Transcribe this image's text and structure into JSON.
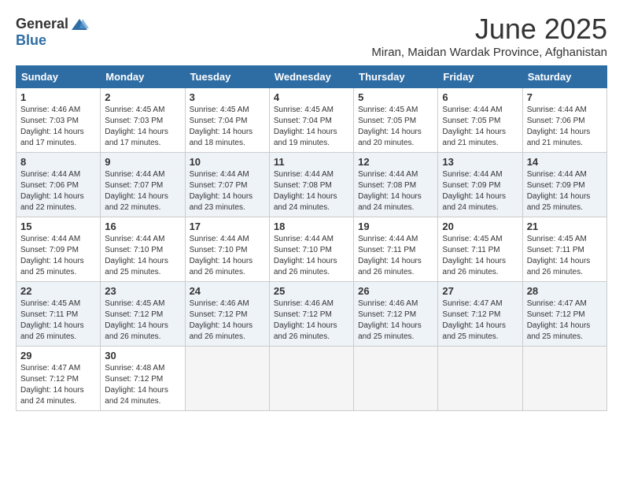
{
  "logo": {
    "general": "General",
    "blue": "Blue"
  },
  "title": "June 2025",
  "location": "Miran, Maidan Wardak Province, Afghanistan",
  "days_header": [
    "Sunday",
    "Monday",
    "Tuesday",
    "Wednesday",
    "Thursday",
    "Friday",
    "Saturday"
  ],
  "weeks": [
    [
      {
        "day": 1,
        "lines": [
          "Sunrise: 4:46 AM",
          "Sunset: 7:03 PM",
          "Daylight: 14 hours",
          "and 17 minutes."
        ]
      },
      {
        "day": 2,
        "lines": [
          "Sunrise: 4:45 AM",
          "Sunset: 7:03 PM",
          "Daylight: 14 hours",
          "and 17 minutes."
        ]
      },
      {
        "day": 3,
        "lines": [
          "Sunrise: 4:45 AM",
          "Sunset: 7:04 PM",
          "Daylight: 14 hours",
          "and 18 minutes."
        ]
      },
      {
        "day": 4,
        "lines": [
          "Sunrise: 4:45 AM",
          "Sunset: 7:04 PM",
          "Daylight: 14 hours",
          "and 19 minutes."
        ]
      },
      {
        "day": 5,
        "lines": [
          "Sunrise: 4:45 AM",
          "Sunset: 7:05 PM",
          "Daylight: 14 hours",
          "and 20 minutes."
        ]
      },
      {
        "day": 6,
        "lines": [
          "Sunrise: 4:44 AM",
          "Sunset: 7:05 PM",
          "Daylight: 14 hours",
          "and 21 minutes."
        ]
      },
      {
        "day": 7,
        "lines": [
          "Sunrise: 4:44 AM",
          "Sunset: 7:06 PM",
          "Daylight: 14 hours",
          "and 21 minutes."
        ]
      }
    ],
    [
      {
        "day": 8,
        "lines": [
          "Sunrise: 4:44 AM",
          "Sunset: 7:06 PM",
          "Daylight: 14 hours",
          "and 22 minutes."
        ]
      },
      {
        "day": 9,
        "lines": [
          "Sunrise: 4:44 AM",
          "Sunset: 7:07 PM",
          "Daylight: 14 hours",
          "and 22 minutes."
        ]
      },
      {
        "day": 10,
        "lines": [
          "Sunrise: 4:44 AM",
          "Sunset: 7:07 PM",
          "Daylight: 14 hours",
          "and 23 minutes."
        ]
      },
      {
        "day": 11,
        "lines": [
          "Sunrise: 4:44 AM",
          "Sunset: 7:08 PM",
          "Daylight: 14 hours",
          "and 24 minutes."
        ]
      },
      {
        "day": 12,
        "lines": [
          "Sunrise: 4:44 AM",
          "Sunset: 7:08 PM",
          "Daylight: 14 hours",
          "and 24 minutes."
        ]
      },
      {
        "day": 13,
        "lines": [
          "Sunrise: 4:44 AM",
          "Sunset: 7:09 PM",
          "Daylight: 14 hours",
          "and 24 minutes."
        ]
      },
      {
        "day": 14,
        "lines": [
          "Sunrise: 4:44 AM",
          "Sunset: 7:09 PM",
          "Daylight: 14 hours",
          "and 25 minutes."
        ]
      }
    ],
    [
      {
        "day": 15,
        "lines": [
          "Sunrise: 4:44 AM",
          "Sunset: 7:09 PM",
          "Daylight: 14 hours",
          "and 25 minutes."
        ]
      },
      {
        "day": 16,
        "lines": [
          "Sunrise: 4:44 AM",
          "Sunset: 7:10 PM",
          "Daylight: 14 hours",
          "and 25 minutes."
        ]
      },
      {
        "day": 17,
        "lines": [
          "Sunrise: 4:44 AM",
          "Sunset: 7:10 PM",
          "Daylight: 14 hours",
          "and 26 minutes."
        ]
      },
      {
        "day": 18,
        "lines": [
          "Sunrise: 4:44 AM",
          "Sunset: 7:10 PM",
          "Daylight: 14 hours",
          "and 26 minutes."
        ]
      },
      {
        "day": 19,
        "lines": [
          "Sunrise: 4:44 AM",
          "Sunset: 7:11 PM",
          "Daylight: 14 hours",
          "and 26 minutes."
        ]
      },
      {
        "day": 20,
        "lines": [
          "Sunrise: 4:45 AM",
          "Sunset: 7:11 PM",
          "Daylight: 14 hours",
          "and 26 minutes."
        ]
      },
      {
        "day": 21,
        "lines": [
          "Sunrise: 4:45 AM",
          "Sunset: 7:11 PM",
          "Daylight: 14 hours",
          "and 26 minutes."
        ]
      }
    ],
    [
      {
        "day": 22,
        "lines": [
          "Sunrise: 4:45 AM",
          "Sunset: 7:11 PM",
          "Daylight: 14 hours",
          "and 26 minutes."
        ]
      },
      {
        "day": 23,
        "lines": [
          "Sunrise: 4:45 AM",
          "Sunset: 7:12 PM",
          "Daylight: 14 hours",
          "and 26 minutes."
        ]
      },
      {
        "day": 24,
        "lines": [
          "Sunrise: 4:46 AM",
          "Sunset: 7:12 PM",
          "Daylight: 14 hours",
          "and 26 minutes."
        ]
      },
      {
        "day": 25,
        "lines": [
          "Sunrise: 4:46 AM",
          "Sunset: 7:12 PM",
          "Daylight: 14 hours",
          "and 26 minutes."
        ]
      },
      {
        "day": 26,
        "lines": [
          "Sunrise: 4:46 AM",
          "Sunset: 7:12 PM",
          "Daylight: 14 hours",
          "and 25 minutes."
        ]
      },
      {
        "day": 27,
        "lines": [
          "Sunrise: 4:47 AM",
          "Sunset: 7:12 PM",
          "Daylight: 14 hours",
          "and 25 minutes."
        ]
      },
      {
        "day": 28,
        "lines": [
          "Sunrise: 4:47 AM",
          "Sunset: 7:12 PM",
          "Daylight: 14 hours",
          "and 25 minutes."
        ]
      }
    ],
    [
      {
        "day": 29,
        "lines": [
          "Sunrise: 4:47 AM",
          "Sunset: 7:12 PM",
          "Daylight: 14 hours",
          "and 24 minutes."
        ]
      },
      {
        "day": 30,
        "lines": [
          "Sunrise: 4:48 AM",
          "Sunset: 7:12 PM",
          "Daylight: 14 hours",
          "and 24 minutes."
        ]
      },
      null,
      null,
      null,
      null,
      null
    ]
  ]
}
